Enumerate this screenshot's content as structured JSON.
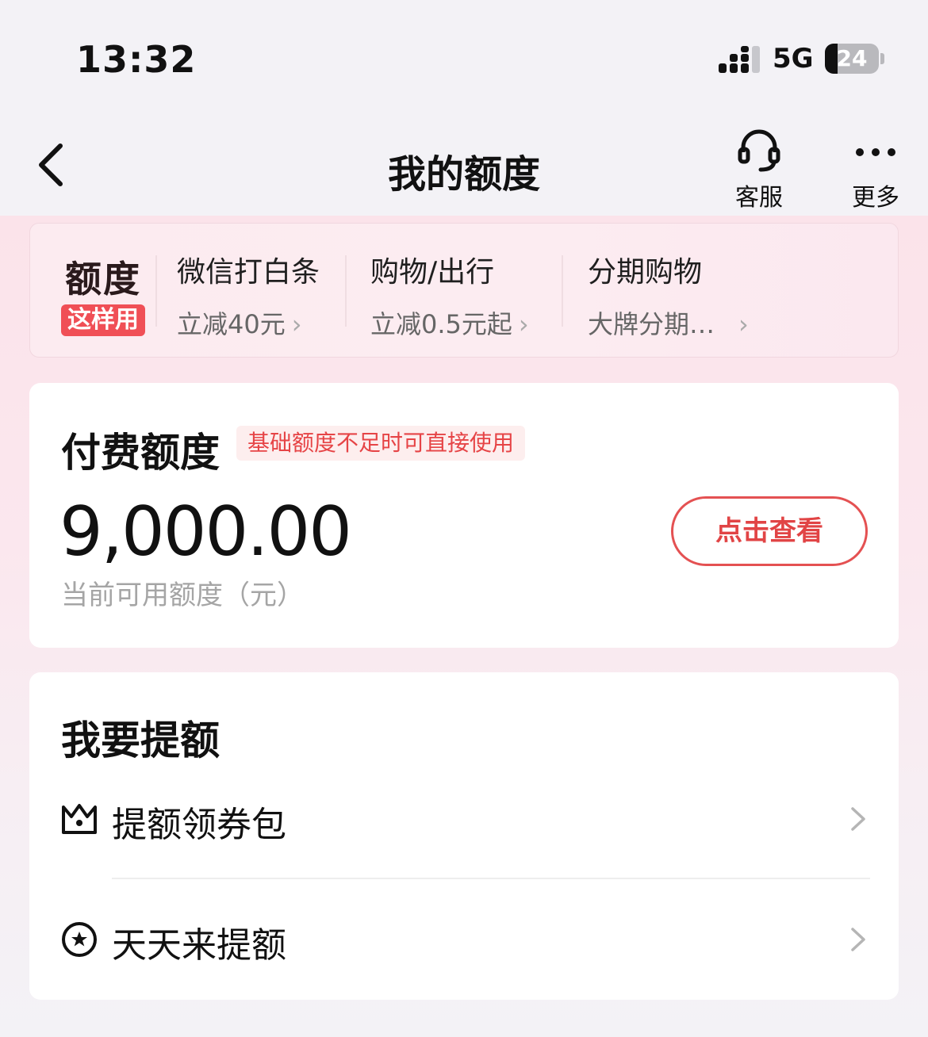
{
  "status_bar": {
    "time": "13:32",
    "network": "5G",
    "battery": "24",
    "battery_level": 0.24
  },
  "nav": {
    "title": "我的额度",
    "service_label": "客服",
    "more_label": "更多",
    "back_icon": "chevron-left-icon",
    "service_icon": "headset-icon",
    "more_icon": "ellipsis-icon"
  },
  "promo": {
    "brand_top": "额度",
    "brand_badge": "这样用",
    "items": [
      {
        "title": "微信打白条",
        "sub": "立减40元"
      },
      {
        "title": "购物/出行",
        "sub": "立减0.5元起"
      },
      {
        "title": "分期购物",
        "sub": "大牌分期…"
      }
    ]
  },
  "fee_card": {
    "title": "付费额度",
    "tag": "基础额度不足时可直接使用",
    "amount": "9,000.00",
    "sub": "当前可用额度（元）",
    "button": "点击查看"
  },
  "raise_card": {
    "title": "我要提额",
    "items": [
      {
        "label": "提额领券包",
        "icon": "crown-icon"
      },
      {
        "label": "天天来提额",
        "icon": "star-circle-icon"
      }
    ]
  },
  "colors": {
    "accent": "#e45152",
    "background": "#f3f2f6",
    "pink": "#fbe3ea"
  }
}
